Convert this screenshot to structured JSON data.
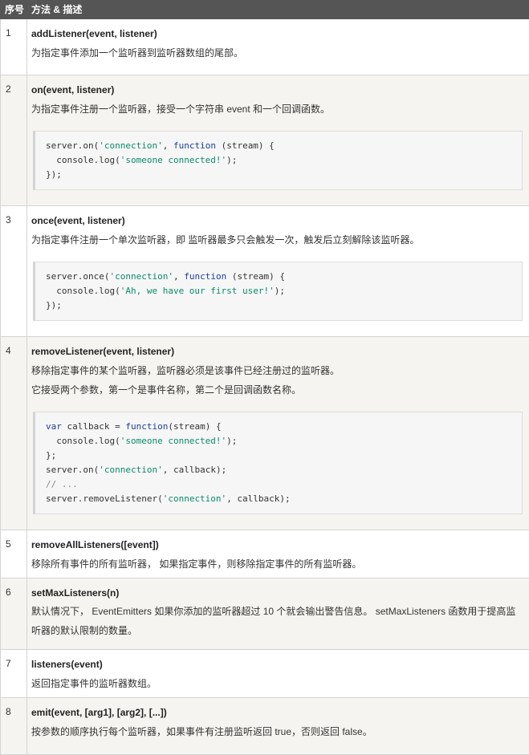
{
  "header": {
    "num": "序号",
    "desc": "方法 & 描述"
  },
  "rows": [
    {
      "num": "1",
      "method": "addListener(event, listener)",
      "lines": [
        "为指定事件添加一个监听器到监听器数组的尾部。"
      ],
      "code": []
    },
    {
      "num": "2",
      "method": "on(event, listener)",
      "lines": [
        "为指定事件注册一个监听器，接受一个字符串 event 和一个回调函数。"
      ],
      "code": [
        [
          {
            "t": "server.on("
          },
          {
            "t": "'connection'",
            "c": "str"
          },
          {
            "t": ", "
          },
          {
            "t": "function",
            "c": "kw"
          },
          {
            "t": " (stream) {"
          }
        ],
        [
          {
            "t": "  console.log("
          },
          {
            "t": "'someone connected!'",
            "c": "str"
          },
          {
            "t": ");"
          }
        ],
        [
          {
            "t": "});"
          }
        ]
      ]
    },
    {
      "num": "3",
      "method": "once(event, listener)",
      "lines": [
        "为指定事件注册一个单次监听器，即 监听器最多只会触发一次，触发后立刻解除该监听器。"
      ],
      "code": [
        [
          {
            "t": "server.once("
          },
          {
            "t": "'connection'",
            "c": "str"
          },
          {
            "t": ", "
          },
          {
            "t": "function",
            "c": "kw"
          },
          {
            "t": " (stream) {"
          }
        ],
        [
          {
            "t": "  console.log("
          },
          {
            "t": "'Ah, we have our first user!'",
            "c": "str"
          },
          {
            "t": ");"
          }
        ],
        [
          {
            "t": "});"
          }
        ]
      ]
    },
    {
      "num": "4",
      "method": "removeListener(event, listener)",
      "lines": [
        "移除指定事件的某个监听器，监听器必须是该事件已经注册过的监听器。",
        "它接受两个参数，第一个是事件名称，第二个是回调函数名称。"
      ],
      "code": [
        [
          {
            "t": "var",
            "c": "kw"
          },
          {
            "t": " callback = "
          },
          {
            "t": "function",
            "c": "kw"
          },
          {
            "t": "(stream) {"
          }
        ],
        [
          {
            "t": "  console.log("
          },
          {
            "t": "'someone connected!'",
            "c": "str"
          },
          {
            "t": ");"
          }
        ],
        [
          {
            "t": "};"
          }
        ],
        [
          {
            "t": "server.on("
          },
          {
            "t": "'connection'",
            "c": "str"
          },
          {
            "t": ", callback);"
          }
        ],
        [
          {
            "t": "// ...",
            "c": "cm"
          }
        ],
        [
          {
            "t": "server.removeListener("
          },
          {
            "t": "'connection'",
            "c": "str"
          },
          {
            "t": ", callback);"
          }
        ]
      ]
    },
    {
      "num": "5",
      "method": "removeAllListeners([event])",
      "lines": [
        "移除所有事件的所有监听器， 如果指定事件，则移除指定事件的所有监听器。"
      ],
      "code": []
    },
    {
      "num": "6",
      "method": "setMaxListeners(n)",
      "lines": [
        "默认情况下， EventEmitters 如果你添加的监听器超过 10 个就会输出警告信息。 setMaxListeners 函数用于提高监听器的默认限制的数量。"
      ],
      "wrap": true,
      "code": []
    },
    {
      "num": "7",
      "method": "listeners(event)",
      "lines": [
        "返回指定事件的监听器数组。"
      ],
      "code": []
    },
    {
      "num": "8",
      "method": "emit(event, [arg1], [arg2], [...])",
      "lines": [
        "按参数的顺序执行每个监听器，如果事件有注册监听返回 true，否则返回 false。"
      ],
      "code": []
    }
  ]
}
